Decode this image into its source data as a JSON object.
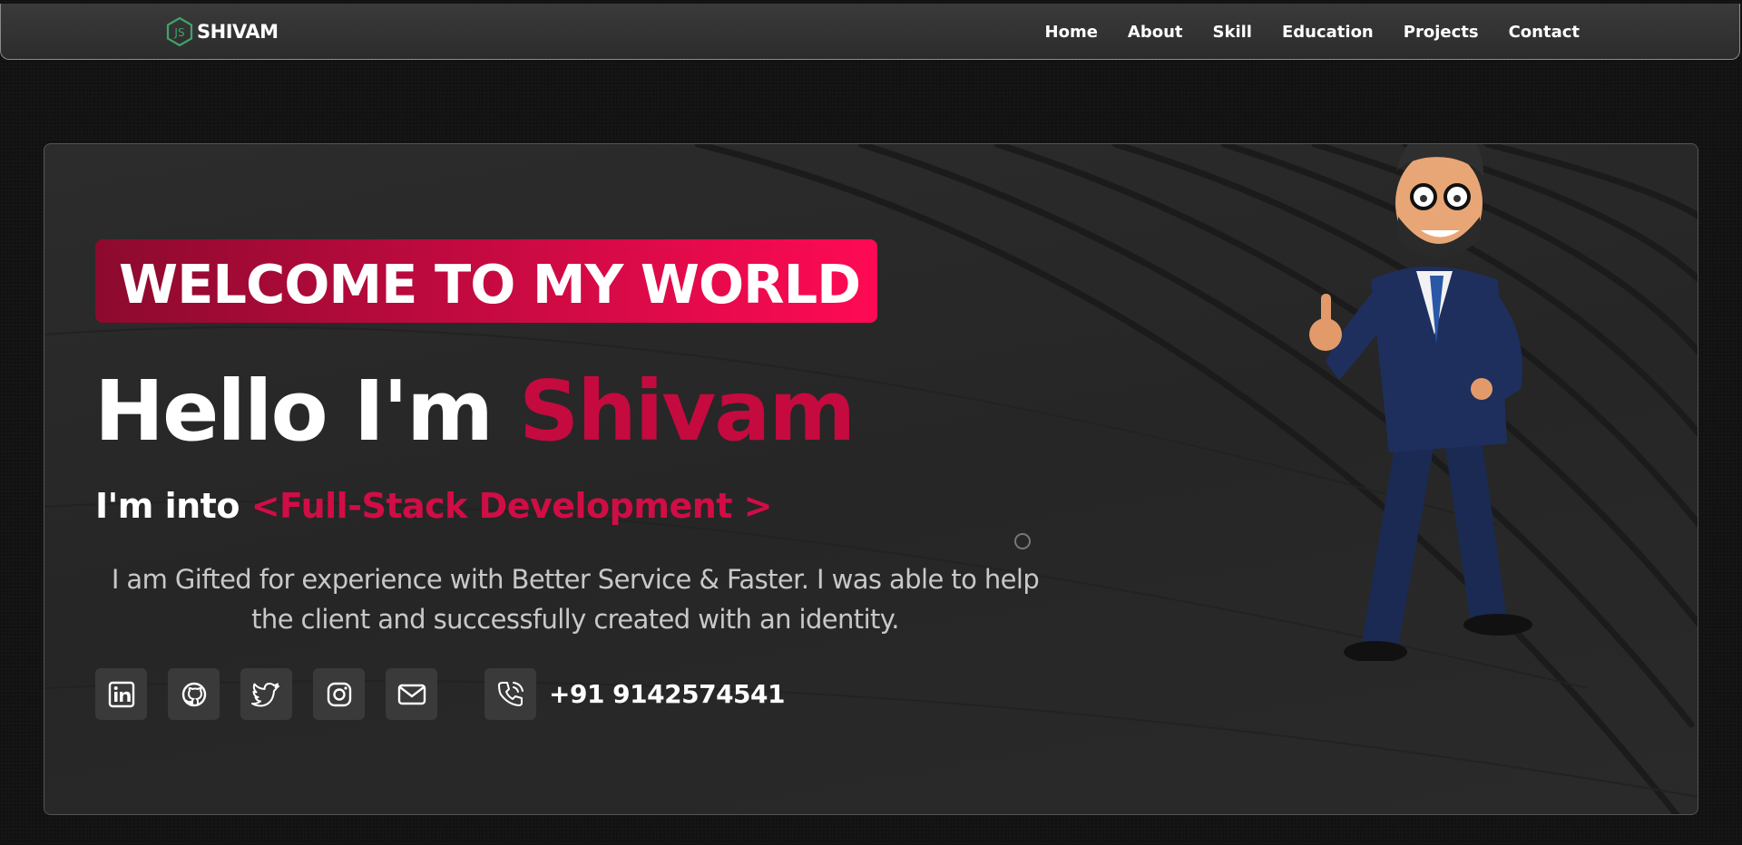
{
  "nav": {
    "brand": "SHIVAM",
    "logo_icon": "nodejs-hexagon-icon",
    "links": [
      "Home",
      "About",
      "Skill",
      "Education",
      "Projects",
      "Contact"
    ]
  },
  "hero": {
    "welcome": "WELCOME TO MY WORLD",
    "hello_prefix": "Hello I'm ",
    "hello_name": "Shivam",
    "into_prefix": "I'm into ",
    "role": "<Full-Stack Development >",
    "description": "I am Gifted for experience with Better Service & Faster. I was able to help the client and successfully created with an identity.",
    "socials": [
      "linkedin-icon",
      "github-icon",
      "twitter-icon",
      "instagram-icon",
      "mail-icon"
    ],
    "phone_icon": "phone-icon",
    "phone": "+91 9142574541"
  },
  "colors": {
    "accent": "#c40a3f",
    "welcome_gradient_start": "#8c0a2e",
    "welcome_gradient_end": "#ff0a54",
    "background": "#121212"
  }
}
